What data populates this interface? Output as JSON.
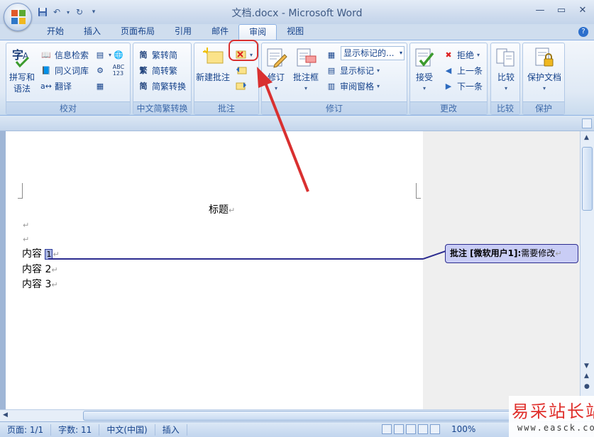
{
  "window": {
    "title": "文档.docx - Microsoft Word"
  },
  "quick_access": {
    "save_icon": "save-icon",
    "undo_icon": "undo-icon",
    "redo_icon": "redo-icon",
    "customize_icon": "customize-icon"
  },
  "tabs": [
    {
      "label": "开始"
    },
    {
      "label": "插入"
    },
    {
      "label": "页面布局"
    },
    {
      "label": "引用"
    },
    {
      "label": "邮件"
    },
    {
      "label": "审阅"
    },
    {
      "label": "视图"
    }
  ],
  "active_tab": "审阅",
  "ribbon": {
    "proofing": {
      "label": "校对",
      "spelling": "拼写和\n语法",
      "spelling_line1": "拼写和",
      "spelling_line2": "语法",
      "research": "信息检索",
      "thesaurus": "同义词库",
      "translate": "翻译"
    },
    "chinese_conversion": {
      "label": "中文简繁转换",
      "to_simplified": "繁转简",
      "to_traditional": "简转繁",
      "convert": "简繁转换"
    },
    "comments": {
      "label": "批注",
      "new_comment": "新建批注"
    },
    "tracking": {
      "label": "修订",
      "track_changes": "修订",
      "balloons": "批注框",
      "display_dropdown": "显示标记的...",
      "show_markup": "显示标记",
      "reviewing_pane": "审阅窗格"
    },
    "changes": {
      "label": "更改",
      "accept": "接受",
      "reject": "拒绝",
      "previous": "上一条",
      "next": "下一条"
    },
    "compare": {
      "label": "比较",
      "compare": "比较"
    },
    "protect": {
      "label": "保护",
      "protect_document": "保护文档"
    }
  },
  "document": {
    "title": "标题",
    "paragraphs": [
      "内容 1",
      "内容 2",
      "内容 3"
    ],
    "p1_text": "内容",
    "p1_marked": "1",
    "p2": "内容 2",
    "p3": "内容 3",
    "para_mark": "↵"
  },
  "comment": {
    "prefix": "批注 [微软用户1]:",
    "text": "需要修改"
  },
  "statusbar": {
    "page": "页面: 1/1",
    "words": "字数: 11",
    "language": "中文(中国)",
    "mode": "插入",
    "zoom": "100%"
  },
  "watermark": {
    "title": "易采站长站",
    "url": "www.easck.com"
  },
  "colors": {
    "accent": "#15428b",
    "highlight": "#d93030",
    "comment_fill": "#c9cdf5",
    "comment_border": "#2b2b8f"
  }
}
